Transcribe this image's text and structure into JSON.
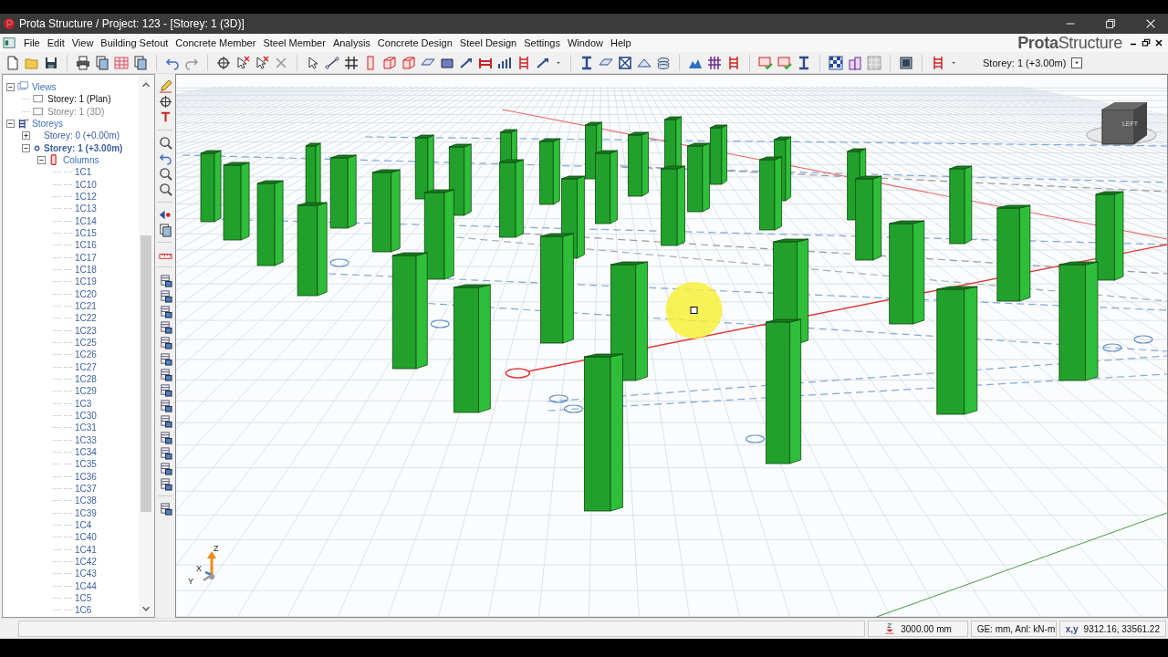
{
  "window": {
    "title": "Prota Structure / Project: 123 - [Storey: 1 (3D)]"
  },
  "menu": [
    "File",
    "Edit",
    "View",
    "Building Setout",
    "Concrete Member",
    "Steel Member",
    "Analysis",
    "Concrete Design",
    "Steel Design",
    "Settings",
    "Window",
    "Help"
  ],
  "logo": "**Prota**Structure",
  "toolbar": {
    "storey_selector": "Storey: 1 (+3.00m)"
  },
  "tree": [
    {
      "label": "Views",
      "kind": "views",
      "expanded": true,
      "children": [
        {
          "label": "Storey: 1 (Plan)",
          "kind": "view",
          "disabled": false
        },
        {
          "label": "Storey: 1 (3D)",
          "kind": "view",
          "disabled": true
        }
      ]
    },
    {
      "label": "Storeys",
      "kind": "storeys",
      "expanded": true,
      "children": [
        {
          "label": "Storey: 0 (+0.00m)",
          "kind": "storey",
          "expanded": false,
          "current": false
        },
        {
          "label": "Storey: 1 (+3.00m)",
          "kind": "storey",
          "expanded": true,
          "current": true,
          "children": [
            {
              "label": "Columns",
              "kind": "columns",
              "expanded": true,
              "children": [
                {
                  "label": "1C1",
                  "kind": "column"
                },
                {
                  "label": "1C10",
                  "kind": "column"
                },
                {
                  "label": "1C12",
                  "kind": "column"
                },
                {
                  "label": "1C13",
                  "kind": "column"
                },
                {
                  "label": "1C14",
                  "kind": "column"
                },
                {
                  "label": "1C15",
                  "kind": "column"
                },
                {
                  "label": "1C16",
                  "kind": "column"
                },
                {
                  "label": "1C17",
                  "kind": "column"
                },
                {
                  "label": "1C18",
                  "kind": "column"
                },
                {
                  "label": "1C19",
                  "kind": "column"
                },
                {
                  "label": "1C20",
                  "kind": "column"
                },
                {
                  "label": "1C21",
                  "kind": "column"
                },
                {
                  "label": "1C22",
                  "kind": "column"
                },
                {
                  "label": "1C23",
                  "kind": "column"
                },
                {
                  "label": "1C25",
                  "kind": "column"
                },
                {
                  "label": "1C26",
                  "kind": "column"
                },
                {
                  "label": "1C27",
                  "kind": "column"
                },
                {
                  "label": "1C28",
                  "kind": "column"
                },
                {
                  "label": "1C29",
                  "kind": "column"
                },
                {
                  "label": "1C3",
                  "kind": "column"
                },
                {
                  "label": "1C30",
                  "kind": "column"
                },
                {
                  "label": "1C31",
                  "kind": "column"
                },
                {
                  "label": "1C33",
                  "kind": "column"
                },
                {
                  "label": "1C34",
                  "kind": "column"
                },
                {
                  "label": "1C35",
                  "kind": "column"
                },
                {
                  "label": "1C36",
                  "kind": "column"
                },
                {
                  "label": "1C37",
                  "kind": "column"
                },
                {
                  "label": "1C38",
                  "kind": "column"
                },
                {
                  "label": "1C39",
                  "kind": "column"
                },
                {
                  "label": "1C4",
                  "kind": "column"
                },
                {
                  "label": "1C40",
                  "kind": "column"
                },
                {
                  "label": "1C41",
                  "kind": "column"
                },
                {
                  "label": "1C42",
                  "kind": "column"
                },
                {
                  "label": "1C43",
                  "kind": "column"
                },
                {
                  "label": "1C44",
                  "kind": "column"
                },
                {
                  "label": "1C5",
                  "kind": "column"
                },
                {
                  "label": "1C6",
                  "kind": "column"
                }
              ]
            }
          ]
        }
      ]
    }
  ],
  "viewport": {
    "view_cube_label": "LEFT",
    "axis_labels": [
      "Z",
      "X",
      "Y"
    ]
  },
  "status_bar": {
    "elevation": "3000.00 mm",
    "units": "GE: mm,  Anl: kN-m",
    "coords_label": "x,y",
    "coords": "9312.16, 33561.22"
  }
}
